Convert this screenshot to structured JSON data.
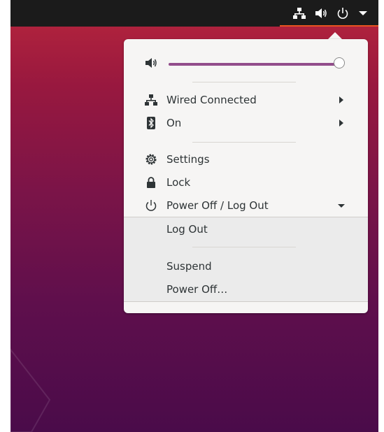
{
  "topbar": {
    "icons": [
      "network-wired-icon",
      "audio-volume-icon",
      "power-icon",
      "menu-arrow-down-icon"
    ]
  },
  "menu": {
    "volume": {
      "icon": "audio-volume-icon",
      "level": 1.0
    },
    "network": {
      "label": "Wired Connected",
      "icon": "network-wired-icon"
    },
    "bluetooth": {
      "label": "On",
      "icon": "bluetooth-icon"
    },
    "settings": {
      "label": "Settings",
      "icon": "settings-gear-icon"
    },
    "lock": {
      "label": "Lock",
      "icon": "lock-icon"
    },
    "power": {
      "label": "Power Off / Log Out",
      "icon": "power-icon"
    },
    "power_submenu": {
      "log_out": "Log Out",
      "suspend": "Suspend",
      "power_off": "Power Off…"
    }
  },
  "colors": {
    "topbar": "#1b1b1b",
    "accent_underline": "#e95420",
    "slider": "#924d8b",
    "menu_bg": "#f6f5f4",
    "submenu_bg": "#ebebeb"
  }
}
